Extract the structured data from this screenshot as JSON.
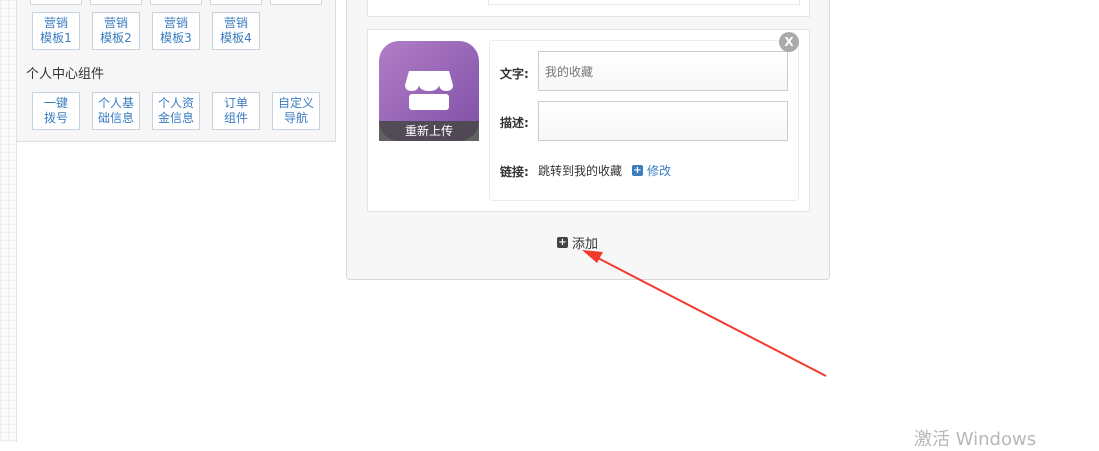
{
  "palette": {
    "marketing_buttons": [
      "营销\n模板1",
      "营销\n模板2",
      "营销\n模板3",
      "营销\n模板4"
    ],
    "section_title": "个人中心组件",
    "personal_buttons": [
      "一键\n拨号",
      "个人基\n础信息",
      "个人资\n金信息",
      "订单\n组件",
      "自定义\n导航"
    ]
  },
  "editor": {
    "item": {
      "close_label": "X",
      "reupload_label": "重新上传",
      "text_label": "文字:",
      "text_value": "我的收藏",
      "desc_label": "描述:",
      "desc_value": "",
      "link_label": "链接:",
      "link_text": "跳转到我的收藏",
      "edit_label": "修改"
    },
    "add_label": "添加"
  },
  "colors": {
    "link_blue": "#3a7cc0",
    "icon_purple": "#9a66b8",
    "arrow_red": "#f23a2f"
  },
  "watermark": "激活 Windows"
}
